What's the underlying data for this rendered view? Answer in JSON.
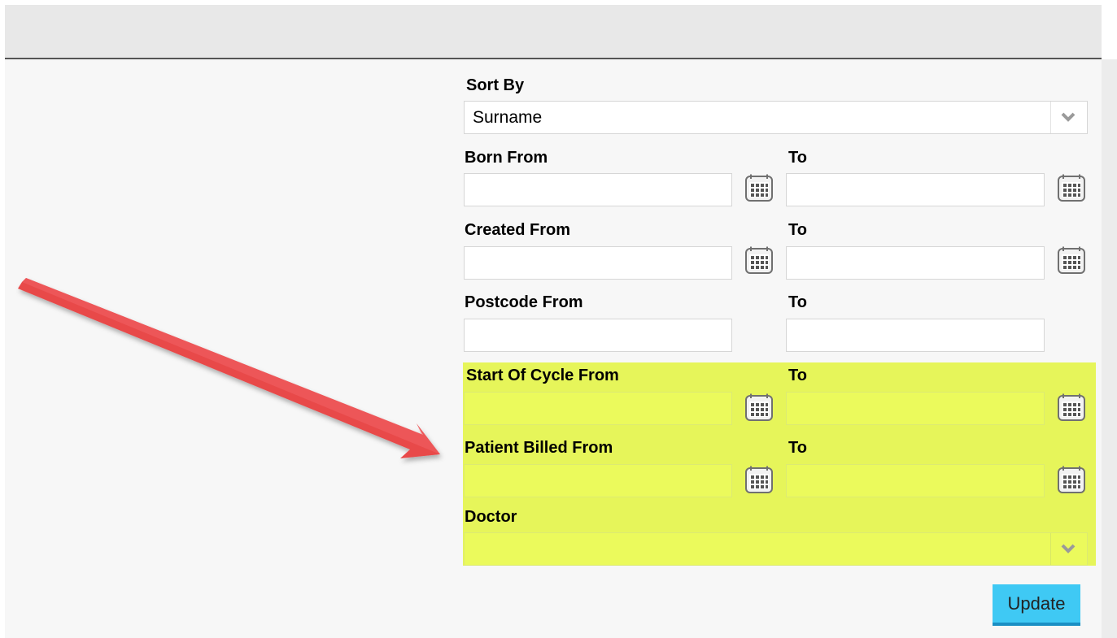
{
  "form": {
    "sort_by": {
      "label": "Sort By",
      "value": "Surname"
    },
    "born": {
      "from_label": "Born From",
      "to_label": "To",
      "from_value": "",
      "to_value": ""
    },
    "created": {
      "from_label": "Created From",
      "to_label": "To",
      "from_value": "",
      "to_value": ""
    },
    "postcode": {
      "from_label": "Postcode From",
      "to_label": "To",
      "from_value": "",
      "to_value": ""
    },
    "start_of_cycle": {
      "from_label": "Start Of Cycle From",
      "to_label": "To",
      "from_value": "",
      "to_value": ""
    },
    "patient_billed": {
      "from_label": "Patient Billed From",
      "to_label": "To",
      "from_value": "",
      "to_value": ""
    },
    "doctor": {
      "label": "Doctor",
      "value": ""
    },
    "update_label": "Update"
  },
  "icons": {
    "calendar": "calendar-icon",
    "dropdown": "chevron-down-icon",
    "annotation": "red-arrow"
  },
  "colors": {
    "highlight": "#e6f55a",
    "update_button": "#3fc9f4",
    "arrow": "#e8484a",
    "calendar_frame": "#6e6e6e"
  }
}
